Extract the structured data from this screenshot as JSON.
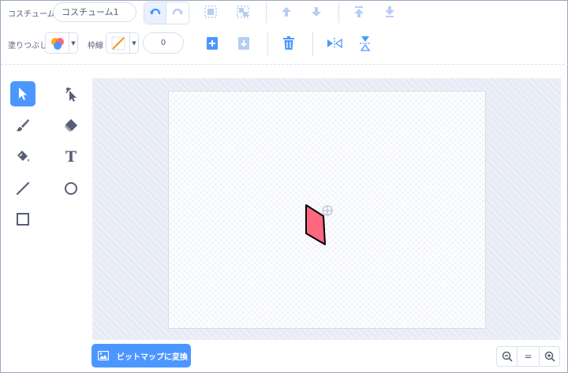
{
  "toolbar": {
    "costume_label": "コスチューム",
    "costume_name": "コスチューム1",
    "fill_label": "塗りつぶし",
    "outline_label": "枠線",
    "outline_width": "0"
  },
  "colors": {
    "accent": "#4c97ff",
    "icon_blue": "#4c97ff",
    "icon_disabled": "#b6cdf4",
    "shape_fill": "#ff6680",
    "canvas_bg": "#e7ebf5"
  },
  "tools": [
    "select-tool",
    "reshape-tool",
    "brush-tool",
    "eraser-tool",
    "fill-tool",
    "text-tool",
    "line-tool",
    "circle-tool",
    "rectangle-tool"
  ],
  "text_tool_glyph": "T",
  "footer": {
    "convert_bitmap_label": "ビットマップに変換",
    "zoom_reset_glyph": "="
  }
}
